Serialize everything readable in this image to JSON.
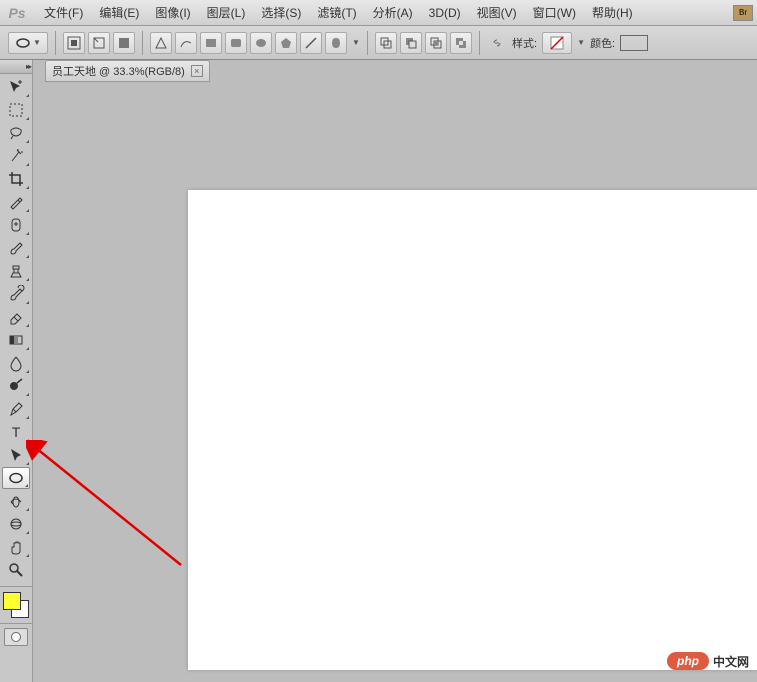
{
  "app": {
    "name": "Ps"
  },
  "menu": {
    "file": "文件(F)",
    "edit": "编辑(E)",
    "image": "图像(I)",
    "layer": "图层(L)",
    "select": "选择(S)",
    "filter": "滤镜(T)",
    "analysis": "分析(A)",
    "threed": "3D(D)",
    "view": "视图(V)",
    "window": "窗口(W)",
    "help": "帮助(H)",
    "bridge_label": "Br"
  },
  "options": {
    "style_label": "样式:",
    "color_label": "颜色:",
    "fill_color": "#ffff33"
  },
  "document": {
    "tab_title": "员工天地 @ 33.3%(RGB/8)"
  },
  "tools": {
    "items": [
      {
        "name": "move-tool"
      },
      {
        "name": "marquee-tool"
      },
      {
        "name": "lasso-tool"
      },
      {
        "name": "magic-wand-tool"
      },
      {
        "name": "crop-tool"
      },
      {
        "name": "eyedropper-tool"
      },
      {
        "name": "healing-brush-tool"
      },
      {
        "name": "brush-tool"
      },
      {
        "name": "clone-stamp-tool"
      },
      {
        "name": "history-brush-tool"
      },
      {
        "name": "eraser-tool"
      },
      {
        "name": "gradient-tool"
      },
      {
        "name": "blur-tool"
      },
      {
        "name": "dodge-tool"
      },
      {
        "name": "pen-tool"
      },
      {
        "name": "type-tool"
      },
      {
        "name": "path-selection-tool"
      },
      {
        "name": "ellipse-shape-tool",
        "selected": true
      },
      {
        "name": "3d-rotate-tool"
      },
      {
        "name": "3d-orbit-tool"
      },
      {
        "name": "hand-tool"
      },
      {
        "name": "zoom-tool"
      }
    ]
  },
  "colors": {
    "foreground": "#ffff33",
    "background": "#ffffff"
  },
  "watermark": {
    "badge": "php",
    "text": "中文网"
  }
}
